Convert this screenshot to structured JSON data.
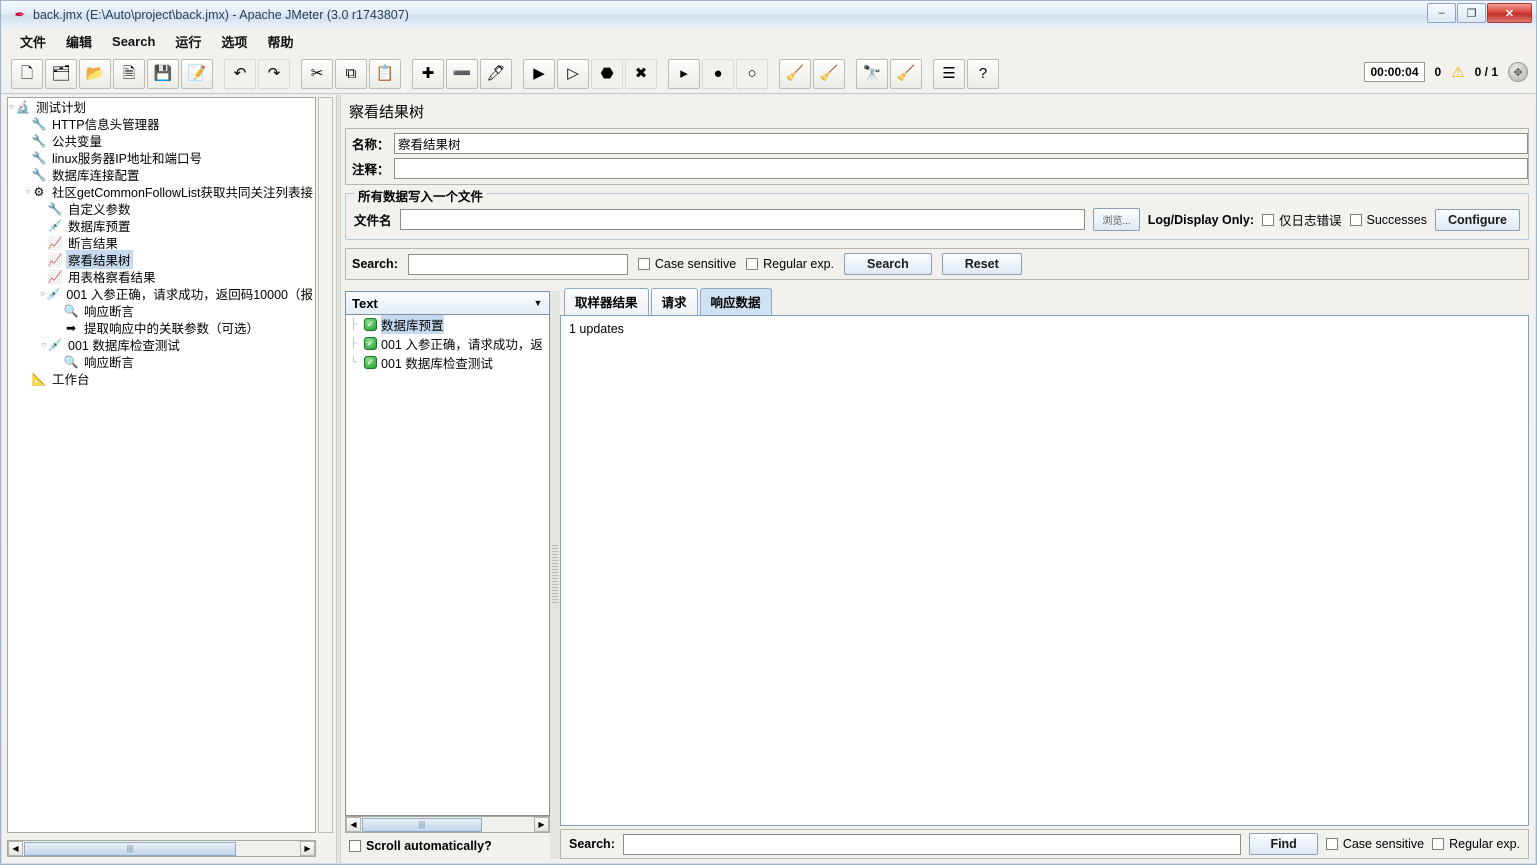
{
  "window": {
    "title": "back.jmx (E:\\Auto\\project\\back.jmx) - Apache JMeter (3.0 r1743807)",
    "app_icon": "jmeter-feather-icon",
    "minimize": "–",
    "maximize": "❐",
    "close": "✕"
  },
  "menu": {
    "items": [
      {
        "label": "文件"
      },
      {
        "label": "编辑"
      },
      {
        "label": "Search"
      },
      {
        "label": "运行"
      },
      {
        "label": "选项"
      },
      {
        "label": "帮助"
      }
    ]
  },
  "toolbar": {
    "buttons": [
      {
        "name": "new-button",
        "glyph": "🗋"
      },
      {
        "name": "templates-button",
        "glyph": "🗂"
      },
      {
        "name": "open-button",
        "glyph": "📂"
      },
      {
        "name": "close-button",
        "glyph": "🗎"
      },
      {
        "name": "save-button",
        "glyph": "💾"
      },
      {
        "name": "save-as-button",
        "glyph": "📝"
      },
      {
        "name": "undo-button",
        "glyph": "↶"
      },
      {
        "name": "redo-button",
        "glyph": "↷"
      },
      {
        "name": "cut-button",
        "glyph": "✂"
      },
      {
        "name": "copy-button",
        "glyph": "⧉"
      },
      {
        "name": "paste-button",
        "glyph": "📋"
      },
      {
        "name": "expand-all-button",
        "glyph": "✚"
      },
      {
        "name": "collapse-all-button",
        "glyph": "➖"
      },
      {
        "name": "toggle-button",
        "glyph": "🖊"
      },
      {
        "name": "start-button",
        "glyph": "▶"
      },
      {
        "name": "start-no-pauses-button",
        "glyph": "▷"
      },
      {
        "name": "stop-button",
        "glyph": "⬣"
      },
      {
        "name": "shutdown-button",
        "glyph": "✖"
      },
      {
        "name": "start-remote-all-button",
        "glyph": "▸"
      },
      {
        "name": "stop-remote-all-button",
        "glyph": "●"
      },
      {
        "name": "shutdown-remote-all-button",
        "glyph": "○"
      },
      {
        "name": "clear-button",
        "glyph": "🧹"
      },
      {
        "name": "clear-all-button",
        "glyph": "🧹"
      },
      {
        "name": "search-button",
        "glyph": "🔭"
      },
      {
        "name": "reset-search-button",
        "glyph": "🧹"
      },
      {
        "name": "function-helper-button",
        "glyph": "☰"
      },
      {
        "name": "help-button",
        "glyph": "?"
      }
    ],
    "separators_after": [
      5,
      7,
      10,
      13,
      17,
      20,
      22,
      24
    ]
  },
  "status": {
    "timer": "00:00:04",
    "warning_count": "0",
    "warning_icon": "warning-triangle-icon",
    "threads": "0 / 1",
    "remote_icon": "remote-engines-icon"
  },
  "tree": {
    "nodes": [
      {
        "depth": 0,
        "icon": "test-plan-icon",
        "glyph": "🔬",
        "label": "测试计划",
        "selected": false,
        "toggle": "○"
      },
      {
        "depth": 1,
        "icon": "config-element-icon",
        "glyph": "🔧",
        "label": "HTTP信息头管理器",
        "selected": false
      },
      {
        "depth": 1,
        "icon": "config-element-icon",
        "glyph": "🔧",
        "label": "公共变量",
        "selected": false
      },
      {
        "depth": 1,
        "icon": "config-element-icon",
        "glyph": "🔧",
        "label": "linux服务器IP地址和端口号",
        "selected": false
      },
      {
        "depth": 1,
        "icon": "config-element-icon",
        "glyph": "🔧",
        "label": "数据库连接配置",
        "selected": false
      },
      {
        "depth": 1,
        "icon": "thread-group-icon",
        "glyph": "⚙",
        "label": "社区getCommonFollowList获取共同关注列表接",
        "selected": false,
        "toggle": "○"
      },
      {
        "depth": 2,
        "icon": "config-element-icon",
        "glyph": "🔧",
        "label": "自定义参数",
        "selected": false
      },
      {
        "depth": 2,
        "icon": "jdbc-request-icon",
        "glyph": "💉",
        "label": "数据库预置",
        "selected": false
      },
      {
        "depth": 2,
        "icon": "listener-icon",
        "glyph": "📈",
        "label": "断言结果",
        "selected": false
      },
      {
        "depth": 2,
        "icon": "listener-icon",
        "glyph": "📈",
        "label": "察看结果树",
        "selected": true
      },
      {
        "depth": 2,
        "icon": "listener-icon",
        "glyph": "📈",
        "label": "用表格察看结果",
        "selected": false
      },
      {
        "depth": 2,
        "icon": "jdbc-request-icon",
        "glyph": "💉",
        "label": "001 入参正确，请求成功，返回码10000（报",
        "selected": false,
        "toggle": "○"
      },
      {
        "depth": 3,
        "icon": "assertion-icon",
        "glyph": "🔍",
        "label": "响应断言",
        "selected": false
      },
      {
        "depth": 3,
        "icon": "post-processor-icon",
        "glyph": "➡",
        "label": "提取响应中的关联参数（可选）",
        "selected": false
      },
      {
        "depth": 2,
        "icon": "jdbc-request-icon",
        "glyph": "💉",
        "label": "001 数据库检查测试",
        "selected": false,
        "toggle": "○"
      },
      {
        "depth": 3,
        "icon": "assertion-icon",
        "glyph": "🔍",
        "label": "响应断言",
        "selected": false
      },
      {
        "depth": 1,
        "icon": "workbench-icon",
        "glyph": "📐",
        "label": "工作台",
        "selected": false
      }
    ]
  },
  "panel": {
    "title": "察看结果树",
    "name_label": "名称：",
    "name_value": "察看结果树",
    "comment_label": "注释：",
    "comment_value": "",
    "file_group_title": "所有数据写入一个文件",
    "filename_label": "文件名",
    "filename_value": "",
    "browse_label": "浏览...",
    "log_display_label": "Log/Display Only:",
    "errors_only_label": "仅日志错误",
    "errors_only_checked": false,
    "successes_label": "Successes",
    "successes_checked": false,
    "configure_label": "Configure"
  },
  "search_bar": {
    "label": "Search:",
    "value": "",
    "case_sensitive_label": "Case sensitive",
    "case_sensitive_checked": false,
    "regex_label": "Regular exp.",
    "regex_checked": false,
    "search_button": "Search",
    "reset_button": "Reset"
  },
  "results": {
    "renderer_selected": "Text",
    "renderer_arrow_icon": "chevron-down-icon",
    "items": [
      {
        "label": "数据库预置",
        "status": "success",
        "selected": true
      },
      {
        "label": "001 入参正确，请求成功，返",
        "status": "success",
        "selected": false
      },
      {
        "label": "001 数据库检查测试",
        "status": "success",
        "selected": false
      }
    ],
    "scroll_auto_label": "Scroll automatically?",
    "scroll_auto_checked": false
  },
  "tabs": [
    {
      "label": "取样器结果",
      "active": false
    },
    {
      "label": "请求",
      "active": false
    },
    {
      "label": "响应数据",
      "active": true
    }
  ],
  "response": {
    "body": "1 updates"
  },
  "find_bar": {
    "label": "Search:",
    "value": "",
    "find_button": "Find",
    "case_sensitive_label": "Case sensitive",
    "case_sensitive_checked": false,
    "regex_label": "Regular exp.",
    "regex_checked": false
  },
  "colors": {
    "selection": "#c5d9ef",
    "active_tab": "#cfe2f3",
    "panel_bg": "#f2f1ed",
    "close_button": "#c0302a",
    "success": "#1f9f30"
  }
}
